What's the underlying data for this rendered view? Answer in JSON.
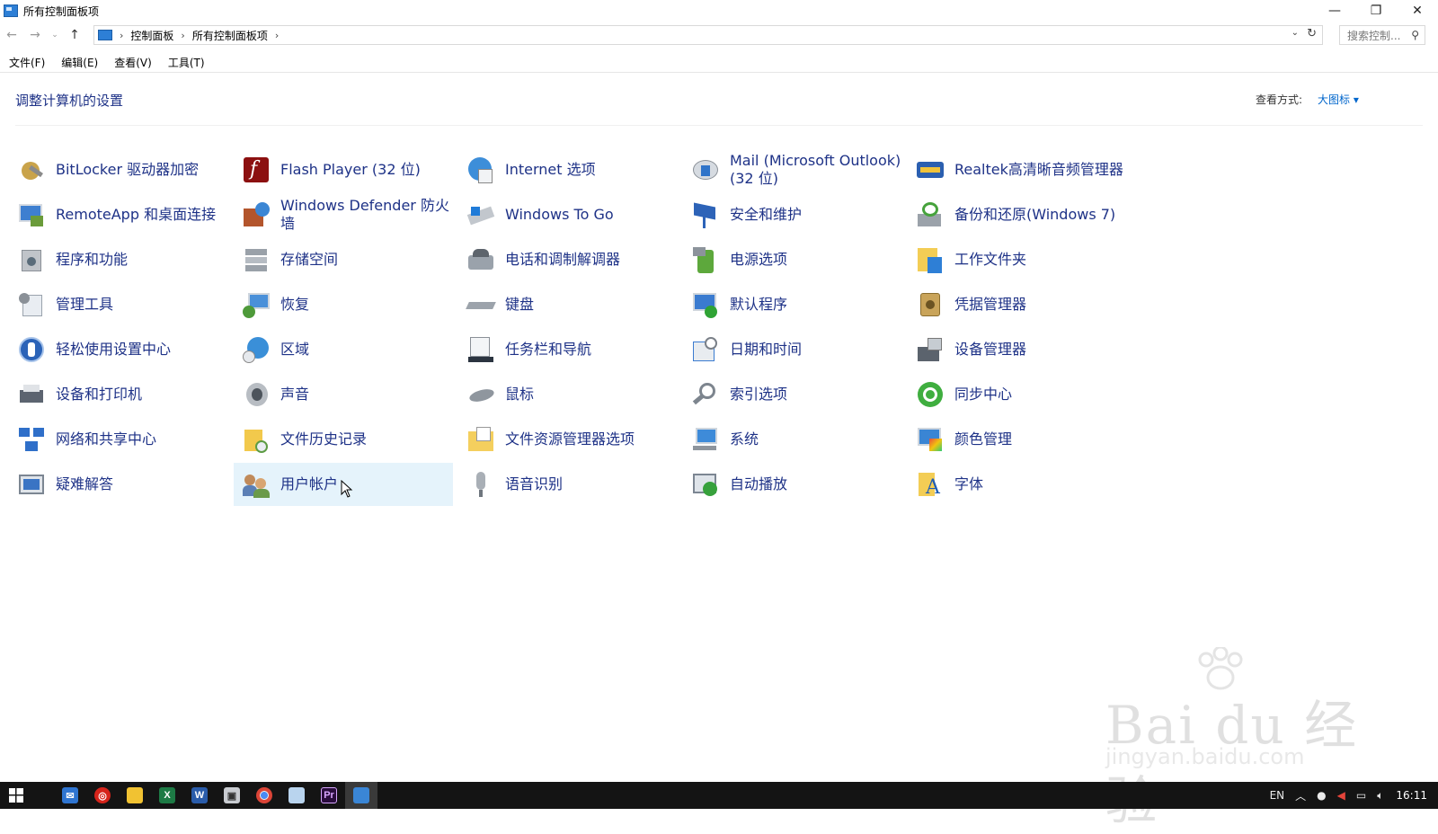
{
  "window": {
    "title": "所有控制面板项",
    "controls": [
      "—",
      "❐",
      "✕"
    ]
  },
  "address": {
    "crumbs": [
      "控制面板",
      "所有控制面板项"
    ],
    "search_placeholder": "搜索控制..."
  },
  "menu": [
    "文件(F)",
    "编辑(E)",
    "查看(V)",
    "工具(T)"
  ],
  "header": {
    "title": "调整计算机的设置",
    "view_by_label": "查看方式:",
    "view_by_value": "大图标 ▾"
  },
  "items": [
    [
      "BitLocker 驱动器加密",
      "RemoteApp 和桌面连接",
      "程序和功能",
      "管理工具",
      "轻松使用设置中心",
      "设备和打印机",
      "网络和共享中心",
      "疑难解答"
    ],
    [
      "Flash Player (32 位)",
      "Windows Defender 防火墙",
      "存储空间",
      "恢复",
      "区域",
      "声音",
      "文件历史记录",
      "用户帐户"
    ],
    [
      "Internet 选项",
      "Windows To Go",
      "电话和调制解调器",
      "键盘",
      "任务栏和导航",
      "鼠标",
      "文件资源管理器选项",
      "语音识别"
    ],
    [
      "Mail (Microsoft Outlook) (32 位)",
      "安全和维护",
      "电源选项",
      "默认程序",
      "日期和时间",
      "索引选项",
      "系统",
      "自动播放"
    ],
    [
      "Realtek高清晰音频管理器",
      "备份和还原(Windows 7)",
      "工作文件夹",
      "凭据管理器",
      "设备管理器",
      "同步中心",
      "颜色管理",
      "字体"
    ]
  ],
  "hovered_item": "用户帐户",
  "taskbar": {
    "tray_lang": "EN",
    "clock": "16:11"
  },
  "watermark": {
    "text": "Bai du 经验",
    "url": "jingyan.baidu.com"
  },
  "colors": {
    "link": "#1e3287",
    "hover_bg": "#e5f3fb",
    "taskbar": "#141414"
  }
}
